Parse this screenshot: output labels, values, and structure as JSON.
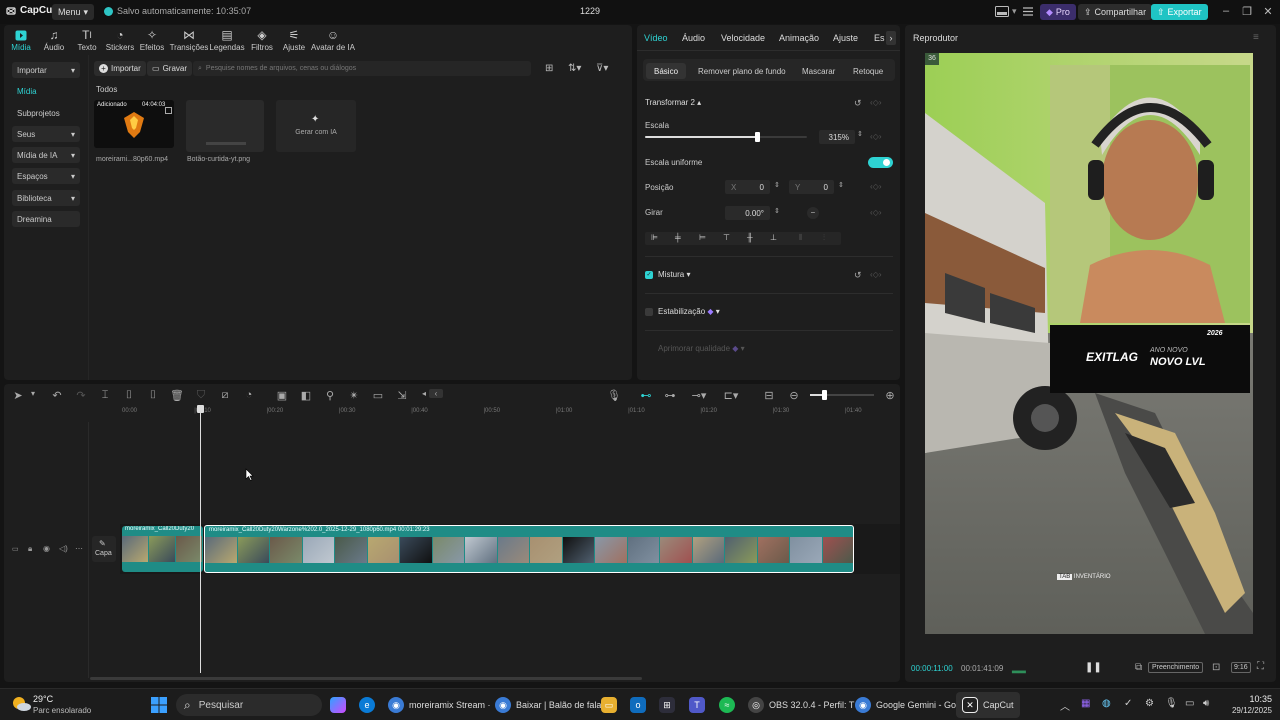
{
  "titlebar": {
    "app_name": "CapCut",
    "menu_label": "Menu",
    "autosave_text": "Salvo automaticamente: 10:35:07",
    "project_name": "1229",
    "pro_label": "Pro",
    "share_label": "Compartilhar",
    "export_label": "Exportar"
  },
  "media_toolbar": {
    "tools": [
      "Mídia",
      "Áudio",
      "Texto",
      "Stickers",
      "Efeitos",
      "Transições",
      "Legendas",
      "Filtros",
      "Ajuste",
      "Avatar de IA"
    ],
    "active_index": 0
  },
  "sidebar": {
    "items": [
      "Importar",
      "Mídia",
      "Subprojetos",
      "Seus",
      "Mídia de IA",
      "Espaços",
      "Biblioteca",
      "Dreamina"
    ]
  },
  "media": {
    "import_label": "Importar",
    "record_label": "Gravar",
    "search_placeholder": "Pesquise nomes de arquivos, cenas ou diálogos",
    "section_label": "Todos",
    "items": [
      {
        "name": "moreirami...80p60.mp4",
        "badge": "Adicionado",
        "duration": "04:04:03"
      },
      {
        "name": "Botão-curtida-yt.png"
      }
    ],
    "ai_generate_label": "Gerar com IA"
  },
  "properties": {
    "tabs": [
      "Vídeo",
      "Áudio",
      "Velocidade",
      "Animação",
      "Ajuste",
      "Es"
    ],
    "subtabs": [
      "Básico",
      "Remover plano de fundo",
      "Mascarar",
      "Retoque"
    ],
    "transform_label": "Transformar 2",
    "scale_label": "Escala",
    "scale_value": "315%",
    "scale_fraction": 0.69,
    "uniform_scale_label": "Escala uniforme",
    "position_label": "Posição",
    "pos_x_label": "X",
    "pos_x": "0",
    "pos_y_label": "Y",
    "pos_y": "0",
    "rotate_label": "Girar",
    "rotate_value": "0.00°",
    "blend_label": "Mistura",
    "stabilize_label": "Estabilização",
    "enhance_label": "Aprimorar qualidade"
  },
  "player": {
    "title": "Reprodutor",
    "current_time": "00:00:11:00",
    "total_time": "00:01:41:09",
    "fill_label": "Preenchimento",
    "ratio_label": "9:16",
    "frame_badge": "36",
    "overlay_brand": "EXITLAG",
    "overlay_line1": "ANO NOVO",
    "overlay_line2": "NOVO LVL",
    "overlay_year": "2026",
    "hud_key": "TAB",
    "hud_text": "INVENTÁRIO"
  },
  "timeline": {
    "ticks": [
      "00:00",
      "|00:10",
      "|00:20",
      "|00:30",
      "|00:40",
      "|00:50",
      "|01:00",
      "|01:10",
      "|01:20",
      "|01:30",
      "|01:40"
    ],
    "cover_label": "Capa",
    "clip1_label": "moreiramix_Call20Duty20",
    "clip2_label": "moreiramix_Call20Duty20Warzone%202.0_2025-12-29_1080p60.mp4   00:01:29:23"
  },
  "taskbar": {
    "weather_temp": "29°C",
    "weather_desc": "Parc ensolarado",
    "search_label": "Pesquisar",
    "apps": [
      {
        "label": "moreiramix Stream ·",
        "color": "#3a7bd5"
      },
      {
        "label": "Baixar | Balão de fala",
        "color": "#3a7bd5"
      },
      {
        "label": "OBS 32.0.4 - Perfil: T",
        "color": "#444444"
      },
      {
        "label": "Google Gemini - Go",
        "color": "#3a7bd5"
      },
      {
        "label": "CapCut",
        "color": "#222222"
      }
    ],
    "time": "10:35",
    "date": "29/12/2025"
  },
  "colors": {
    "accent": "#2ed3d3",
    "export": "#1fc4c4",
    "clip": "#1f8c86"
  }
}
